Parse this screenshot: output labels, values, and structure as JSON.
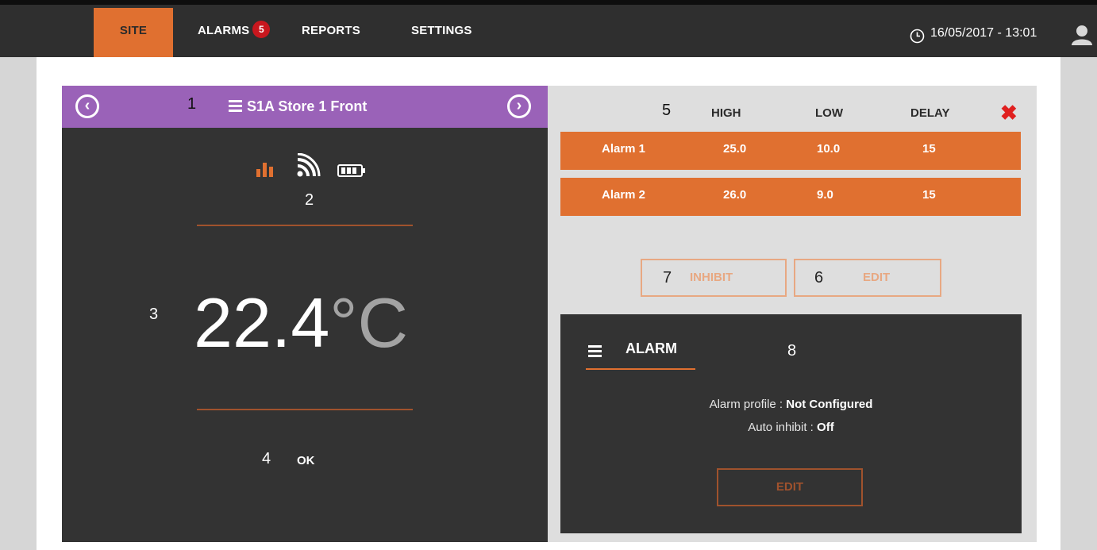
{
  "nav": {
    "site": "SITE",
    "alarms": "ALARMS",
    "alarms_badge": "5",
    "reports": "REPORTS",
    "settings": "SETTINGS",
    "datetime": "16/05/2017 - 13:01"
  },
  "sensor": {
    "header_number": "1",
    "title": "S1A Store 1 Front",
    "icons_number": "2",
    "icons": [
      "bar-chart-icon",
      "wifi-signal-icon",
      "battery-icon"
    ],
    "temp_number": "3",
    "temperature": "22.4",
    "unit": "°C",
    "status_number": "4",
    "status": "OK"
  },
  "alarm_table": {
    "number": "5",
    "headers": [
      "HIGH",
      "LOW",
      "DELAY"
    ],
    "rows": [
      {
        "name": "Alarm 1",
        "high": "25.0",
        "low": "10.0",
        "delay": "15"
      },
      {
        "name": "Alarm 2",
        "high": "26.0",
        "low": "9.0",
        "delay": "15"
      }
    ]
  },
  "buttons": {
    "inhibit_number": "7",
    "inhibit": "INHIBIT",
    "edit_number": "6",
    "edit": "EDIT"
  },
  "alarm_panel": {
    "title": "ALARM",
    "number": "8",
    "profile_label": "Alarm profile :",
    "profile_value": "Not Configured",
    "inhibit_label": "Auto inhibit :",
    "inhibit_value": "Off",
    "edit": "EDIT"
  },
  "colors": {
    "accent": "#e07030",
    "header_purple": "#9a62b8",
    "panel_dark": "#333333",
    "badge_red": "#c8171e"
  }
}
